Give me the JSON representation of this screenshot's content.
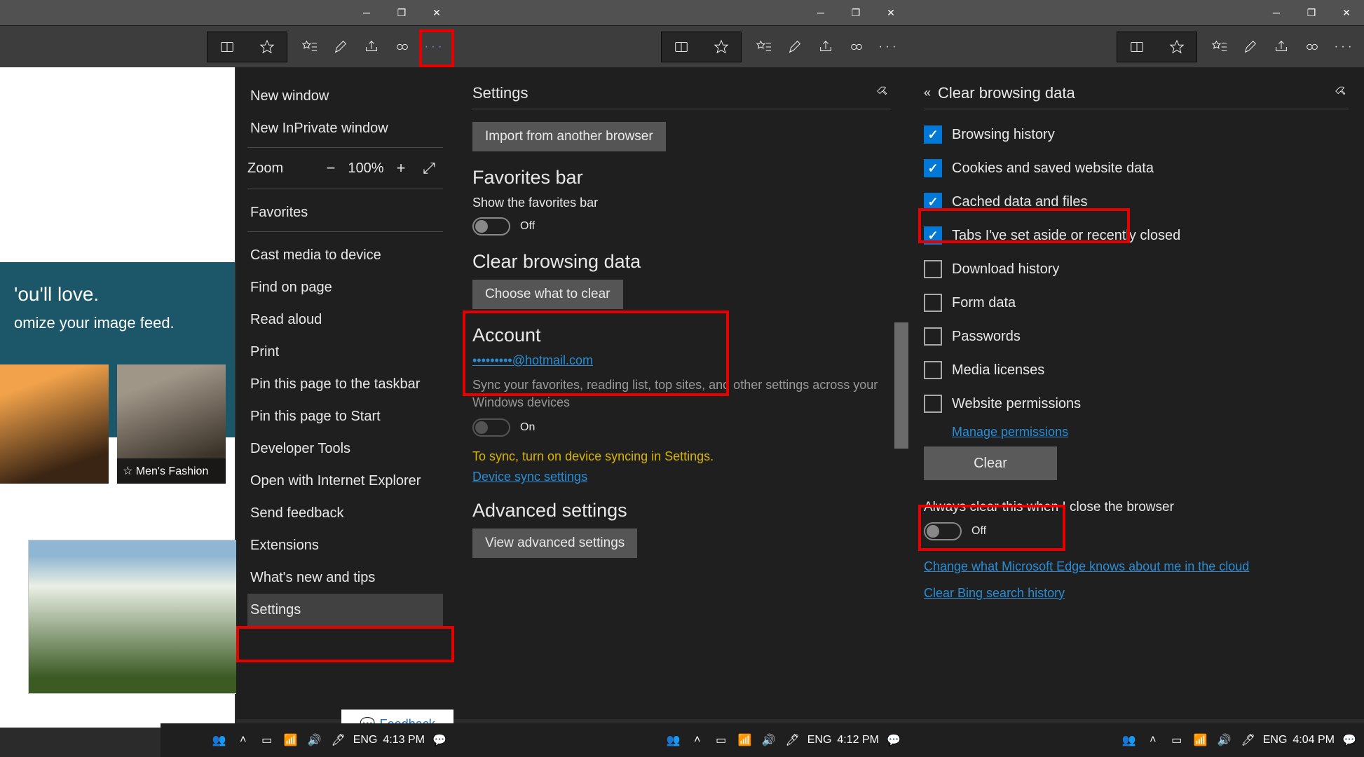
{
  "titlebar": {
    "minimize": "—",
    "maximize": "❐",
    "close": "✕"
  },
  "p1": {
    "menu": {
      "new_window": "New window",
      "new_inprivate": "New InPrivate window",
      "zoom_label": "Zoom",
      "zoom_value": "100%",
      "favorites": "Favorites",
      "cast": "Cast media to device",
      "find": "Find on page",
      "read_aloud": "Read aloud",
      "print": "Print",
      "pin_taskbar": "Pin this page to the taskbar",
      "pin_start": "Pin this page to Start",
      "devtools": "Developer Tools",
      "open_ie": "Open with Internet Explorer",
      "feedback": "Send feedback",
      "extensions": "Extensions",
      "whatsnew": "What's new and tips",
      "settings": "Settings"
    },
    "blue_band": {
      "line1": "'ou'll love.",
      "line2": "omize your image feed."
    },
    "thumb2_caption": "☆ Men's Fashion",
    "feedback_button": "Feedback",
    "taskbar": {
      "lang": "ENG",
      "time": "4:13 PM"
    }
  },
  "p2": {
    "header": "Settings",
    "import_btn": "Import from another browser",
    "favbar_title": "Favorites bar",
    "favbar_show": "Show the favorites bar",
    "favbar_state": "Off",
    "cbd_title": "Clear browsing data",
    "choose_btn": "Choose what to clear",
    "account_title": "Account",
    "account_email": "•••••••••@hotmail.com",
    "sync_desc": "Sync your favorites, reading list, top sites, and other settings across your Windows devices",
    "sync_state": "On",
    "sync_warn": "To sync, turn on device syncing in Settings.",
    "sync_link": "Device sync settings",
    "adv_title": "Advanced settings",
    "adv_btn": "View advanced settings",
    "taskbar": {
      "lang": "ENG",
      "time": "4:12 PM"
    }
  },
  "p3": {
    "header": "Clear browsing data",
    "items": [
      {
        "label": "Browsing history",
        "checked": true
      },
      {
        "label": "Cookies and saved website data",
        "checked": true
      },
      {
        "label": "Cached data and files",
        "checked": true
      },
      {
        "label": "Tabs I've set aside or recently closed",
        "checked": true
      },
      {
        "label": "Download history",
        "checked": false
      },
      {
        "label": "Form data",
        "checked": false
      },
      {
        "label": "Passwords",
        "checked": false
      },
      {
        "label": "Media licenses",
        "checked": false
      },
      {
        "label": "Website permissions",
        "checked": false
      }
    ],
    "manage_link": "Manage permissions",
    "clear_btn": "Clear",
    "always_label": "Always clear this when I close the browser",
    "always_state": "Off",
    "link1": "Change what Microsoft Edge knows about me in the cloud",
    "link2": "Clear Bing search history",
    "taskbar": {
      "lang": "ENG",
      "time": "4:04 PM"
    }
  }
}
